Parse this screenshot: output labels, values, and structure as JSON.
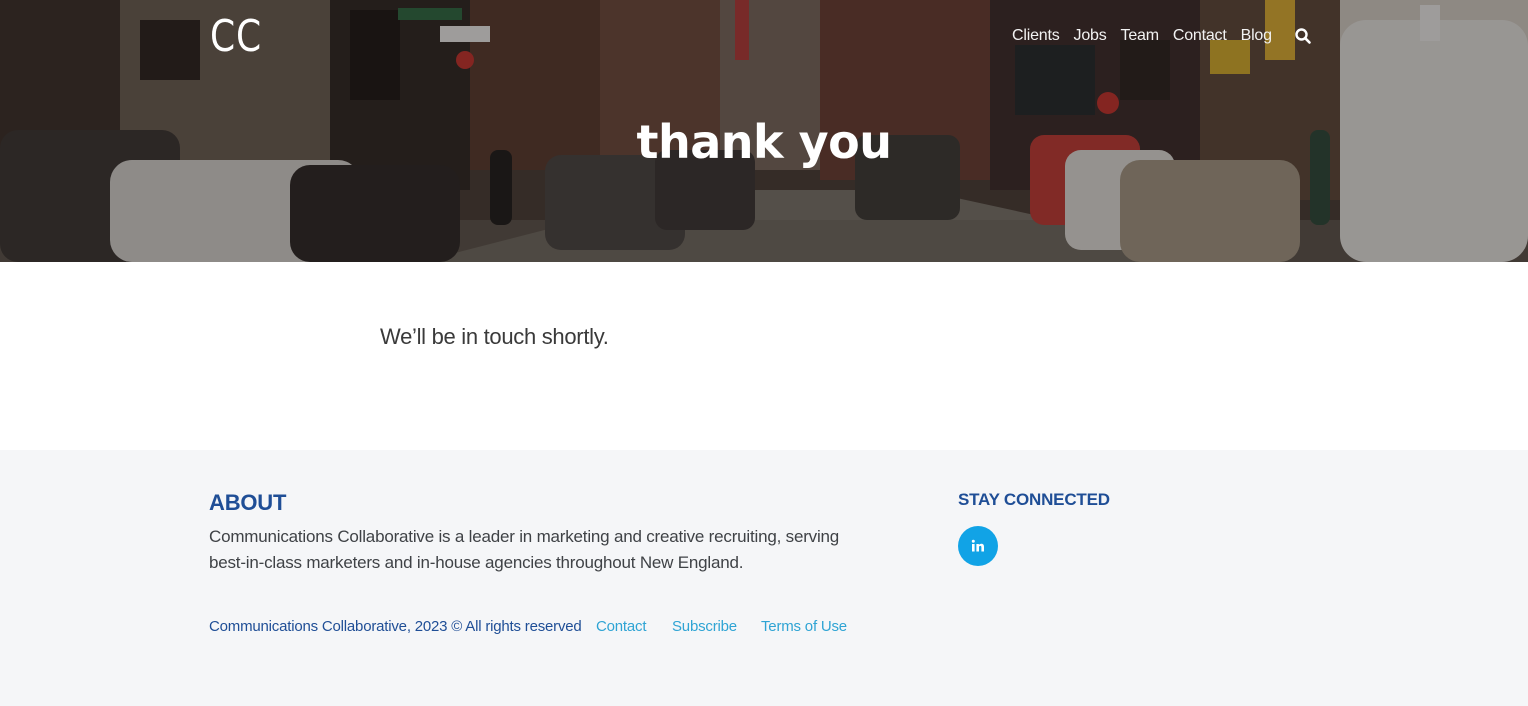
{
  "header": {
    "logo_text": "CC",
    "nav": {
      "clients": "Clients",
      "jobs": "Jobs",
      "team": "Team",
      "contact": "Contact",
      "blog": "Blog"
    },
    "search_icon": "search-icon",
    "hero_title": "thank you"
  },
  "main": {
    "message": "We’ll be in touch shortly."
  },
  "footer": {
    "about_heading": "ABOUT",
    "about_text": "Communications Collaborative is a leader in marketing and creative recruiting, serving best-in-class marketers and in-house agencies throughout New England.",
    "copyright": "Communications Collaborative, 2023 © All rights reserved",
    "links": {
      "contact": "Contact",
      "subscribe": "Subscribe",
      "terms": "Terms of Use"
    },
    "stay_connected_heading": "STAY CONNECTED",
    "social_icon": "linkedin-icon",
    "social_label": "in"
  },
  "colors": {
    "brand_blue": "#1f4e96",
    "link_blue": "#2fa4d4",
    "linkedin_blue": "#11a3e6",
    "footer_bg": "#f5f6f8"
  }
}
